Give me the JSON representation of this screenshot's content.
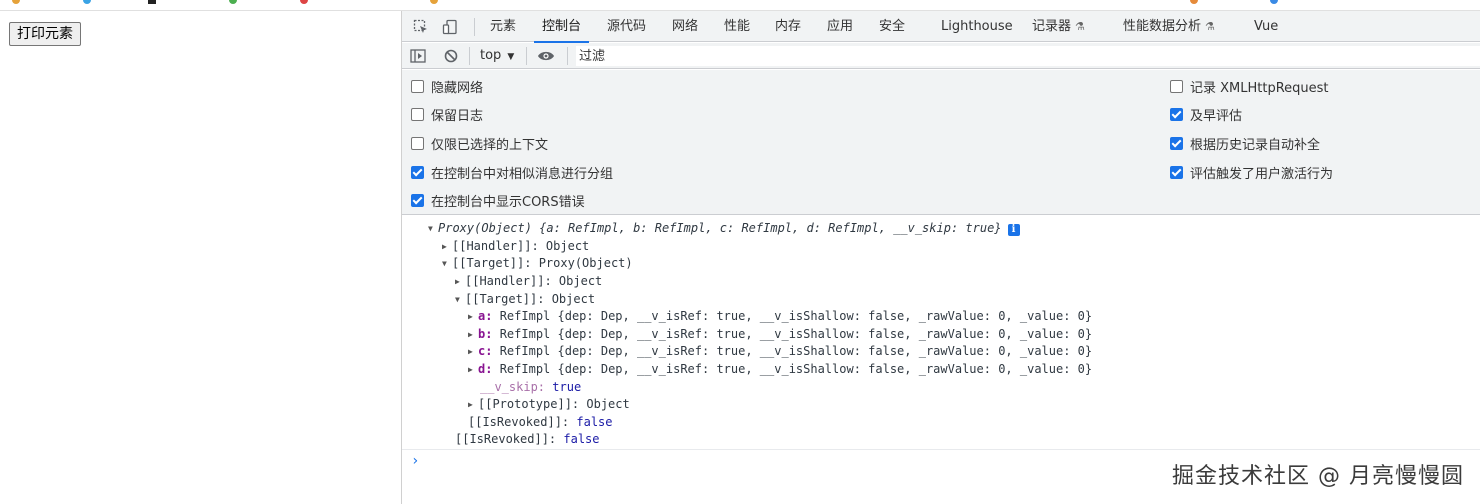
{
  "page": {
    "print_button_label": "打印元素"
  },
  "devtools": {
    "tabs": [
      "元素",
      "控制台",
      "源代码",
      "网络",
      "性能",
      "内存",
      "应用",
      "安全",
      "Lighthouse",
      "记录器",
      "性能数据分析",
      "Vue"
    ],
    "active_tab": "控制台",
    "toolbar": {
      "context_label": "top",
      "filter_placeholder": "过滤"
    },
    "settings_left": [
      {
        "label": "隐藏网络",
        "checked": false
      },
      {
        "label": "保留日志",
        "checked": false
      },
      {
        "label": "仅限已选择的上下文",
        "checked": false
      },
      {
        "label": "在控制台中对相似消息进行分组",
        "checked": true
      },
      {
        "label": "在控制台中显示CORS错误",
        "checked": true
      }
    ],
    "settings_right": [
      {
        "label": "记录 XMLHttpRequest",
        "checked": false
      },
      {
        "label": "及早评估",
        "checked": true
      },
      {
        "label": "根据历史记录自动补全",
        "checked": true
      },
      {
        "label": "评估触发了用户激活行为",
        "checked": true
      }
    ],
    "console": {
      "root_label": "Proxy(Object)",
      "root_preview": "{a: RefImpl, b: RefImpl, c: RefImpl, d: RefImpl, __v_skip: true}",
      "handler_label": "[[Handler]]: Object",
      "target_label": "[[Target]]: Proxy(Object)",
      "inner_handler_label": "[[Handler]]: Object",
      "inner_target_label": "[[Target]]: Object",
      "refs": [
        {
          "key": "a",
          "value": "RefImpl {dep: Dep, __v_isRef: true, __v_isShallow: false, _rawValue: 0, _value: 0}"
        },
        {
          "key": "b",
          "value": "RefImpl {dep: Dep, __v_isRef: true, __v_isShallow: false, _rawValue: 0, _value: 0}"
        },
        {
          "key": "c",
          "value": "RefImpl {dep: Dep, __v_isRef: true, __v_isShallow: false, _rawValue: 0, _value: 0}"
        },
        {
          "key": "d",
          "value": "RefImpl {dep: Dep, __v_isRef: true, __v_isShallow: false, _rawValue: 0, _value: 0}"
        }
      ],
      "v_skip_key": "__v_skip",
      "v_skip_value": "true",
      "prototype_label": "[[Prototype]]: Object",
      "inner_revoked_key": "[[IsRevoked]]",
      "inner_revoked_value": "false",
      "outer_revoked_key": "[[IsRevoked]]",
      "outer_revoked_value": "false",
      "prompt": "›"
    }
  },
  "watermark": "掘金技术社区 @ 月亮慢慢圆",
  "colors": {
    "accent": "#1a73e8",
    "panel_bg": "#f1f3f4",
    "property_key": "#881391",
    "keyword_value": "#1a1aa6"
  },
  "icons": [
    "inspect-element-icon",
    "device-toolbar-icon",
    "sidebar-toggle-icon",
    "clear-console-icon",
    "context-dropdown-icon",
    "live-expression-eye-icon",
    "info-icon",
    "experiment-flask-icon"
  ]
}
